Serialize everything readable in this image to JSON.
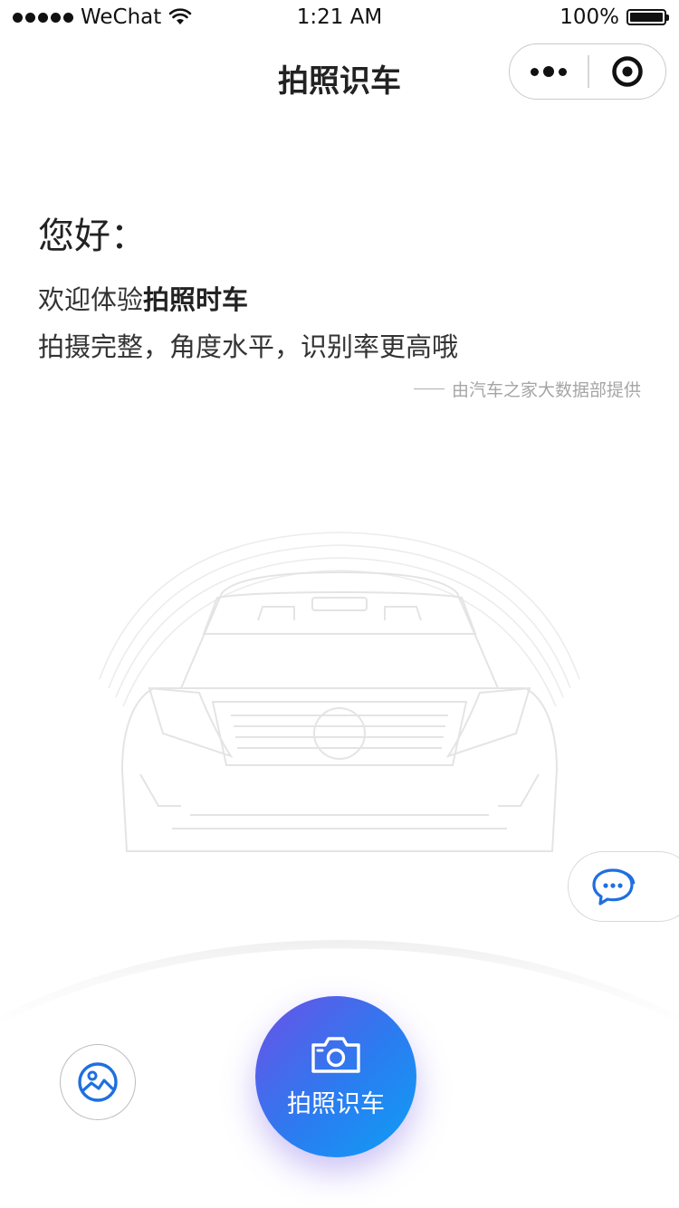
{
  "status_bar": {
    "carrier": "WeChat",
    "time": "1:21 AM",
    "battery": "100%"
  },
  "nav": {
    "title": "拍照识车",
    "more_icon": "more-dots-icon",
    "close_icon": "target-icon"
  },
  "intro": {
    "greeting": "您好：",
    "welcome_prefix": "欢迎体验",
    "welcome_brand": "拍照时车",
    "tip": "拍摄完整，角度水平，识别率更高哦",
    "source": "由汽车之家大数据部提供"
  },
  "chat_icon": "chat-bubble-icon",
  "gallery_icon": "gallery-icon",
  "shoot": {
    "icon": "camera-icon",
    "label": "拍照识车"
  },
  "colors": {
    "accent": "#2b7cf0",
    "gradient_start": "#6b51e6",
    "gradient_end": "#0d9ff5",
    "icon_blue": "#1f6fe0"
  }
}
